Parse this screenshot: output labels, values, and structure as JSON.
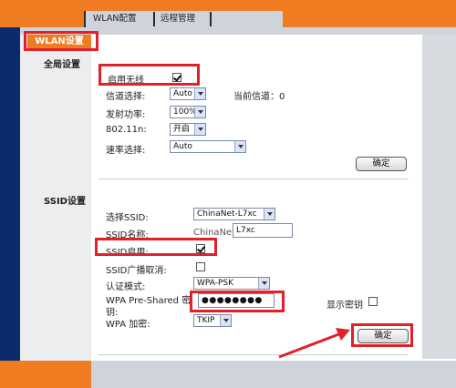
{
  "tabs": [
    {
      "label": "WLAN配置"
    },
    {
      "label": "远程管理"
    }
  ],
  "sidebar": {
    "title": "WLAN设置"
  },
  "global": {
    "section_title": "全局设置",
    "enable_wireless_label": "启用无线",
    "enable_wireless_checked": true,
    "channel_label": "信道选择:",
    "channel_value": "Auto",
    "current_channel_label": "当前信道：0",
    "power_label": "发射功率:",
    "power_value": "100%",
    "n_label": "802.11n:",
    "n_value": "开启",
    "rate_label": "速率选择:",
    "rate_value": "Auto",
    "confirm_label": "确定"
  },
  "ssid": {
    "section_title": "SSID设置",
    "select_label": "选择SSID:",
    "select_value": "ChinaNet-L7xc",
    "name_label": "SSID名称:",
    "name_prefix": "ChinaNet-",
    "name_value": "L7xc",
    "enable_label": "SSID启用:",
    "enable_checked": true,
    "broadcast_label": "SSID广播取消:",
    "broadcast_checked": false,
    "auth_label": "认证模式:",
    "auth_value": "WPA-PSK",
    "psk_label_line1": "WPA Pre-Shared 密",
    "psk_label_line2": "钥:",
    "psk_value": "●●●●●●●●",
    "show_key_label": "显示密钥",
    "show_key_checked": false,
    "encryption_label": "WPA 加密:",
    "encryption_value": "TKIP",
    "confirm_label": "确定"
  },
  "colors": {
    "accent": "#f07c22",
    "highlight": "#e2202a",
    "nav": "#0b2b6e"
  }
}
